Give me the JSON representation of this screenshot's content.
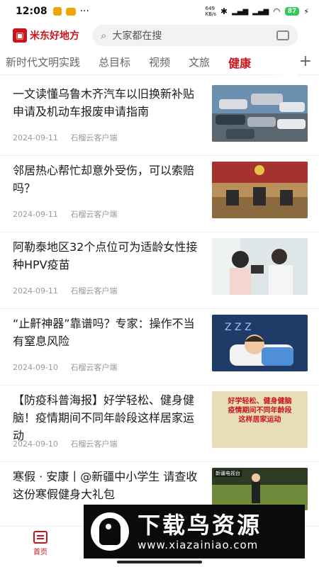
{
  "status": {
    "time": "12:08",
    "net_speed": "649\nKB/s",
    "battery": "87"
  },
  "app": {
    "name": "米东好地方",
    "search_placeholder": "大家都在搜"
  },
  "tabs": [
    {
      "label": "新时代文明实践"
    },
    {
      "label": "总目标"
    },
    {
      "label": "视频"
    },
    {
      "label": "文旅"
    },
    {
      "label": "健康"
    }
  ],
  "feed": [
    {
      "title": "一文读懂乌鲁木齐汽车以旧换新补贴申请及机动车报废申请指南",
      "date": "2024-09-11",
      "source": "石榴云客户端"
    },
    {
      "title": "邻居热心帮忙却意外受伤，可以索赔吗？",
      "date": "2024-09-11",
      "source": "石榴云客户端"
    },
    {
      "title": "阿勒泰地区32个点位可为适龄女性接种HPV疫苗",
      "date": "2024-09-11",
      "source": "石榴云客户端"
    },
    {
      "title": "“止鼾神器”靠谱吗？专家：操作不当有窒息风险",
      "date": "2024-09-10",
      "source": "石榴云客户端"
    },
    {
      "title": "【防疫科普海报】好学轻松、健身健脑！疫情期间不同年龄段这样居家运动",
      "date": "2024-09-10",
      "source": "石榴云客户端"
    },
    {
      "title": "寒假 · 安康丨@新疆中小学生 请查收这份寒假健身大礼包",
      "date": "",
      "source": ""
    }
  ],
  "poster_text": "好学轻松、健身健脑\n疫情期间不同年龄段\n这样居家运动",
  "thumb6_tag": "新疆电视台",
  "bottom_tab": {
    "home_label": "首页"
  },
  "watermark": {
    "title": "下载鸟资源",
    "url": "www.xiazainiao.com"
  },
  "colors": {
    "brand": "#c8161d"
  }
}
